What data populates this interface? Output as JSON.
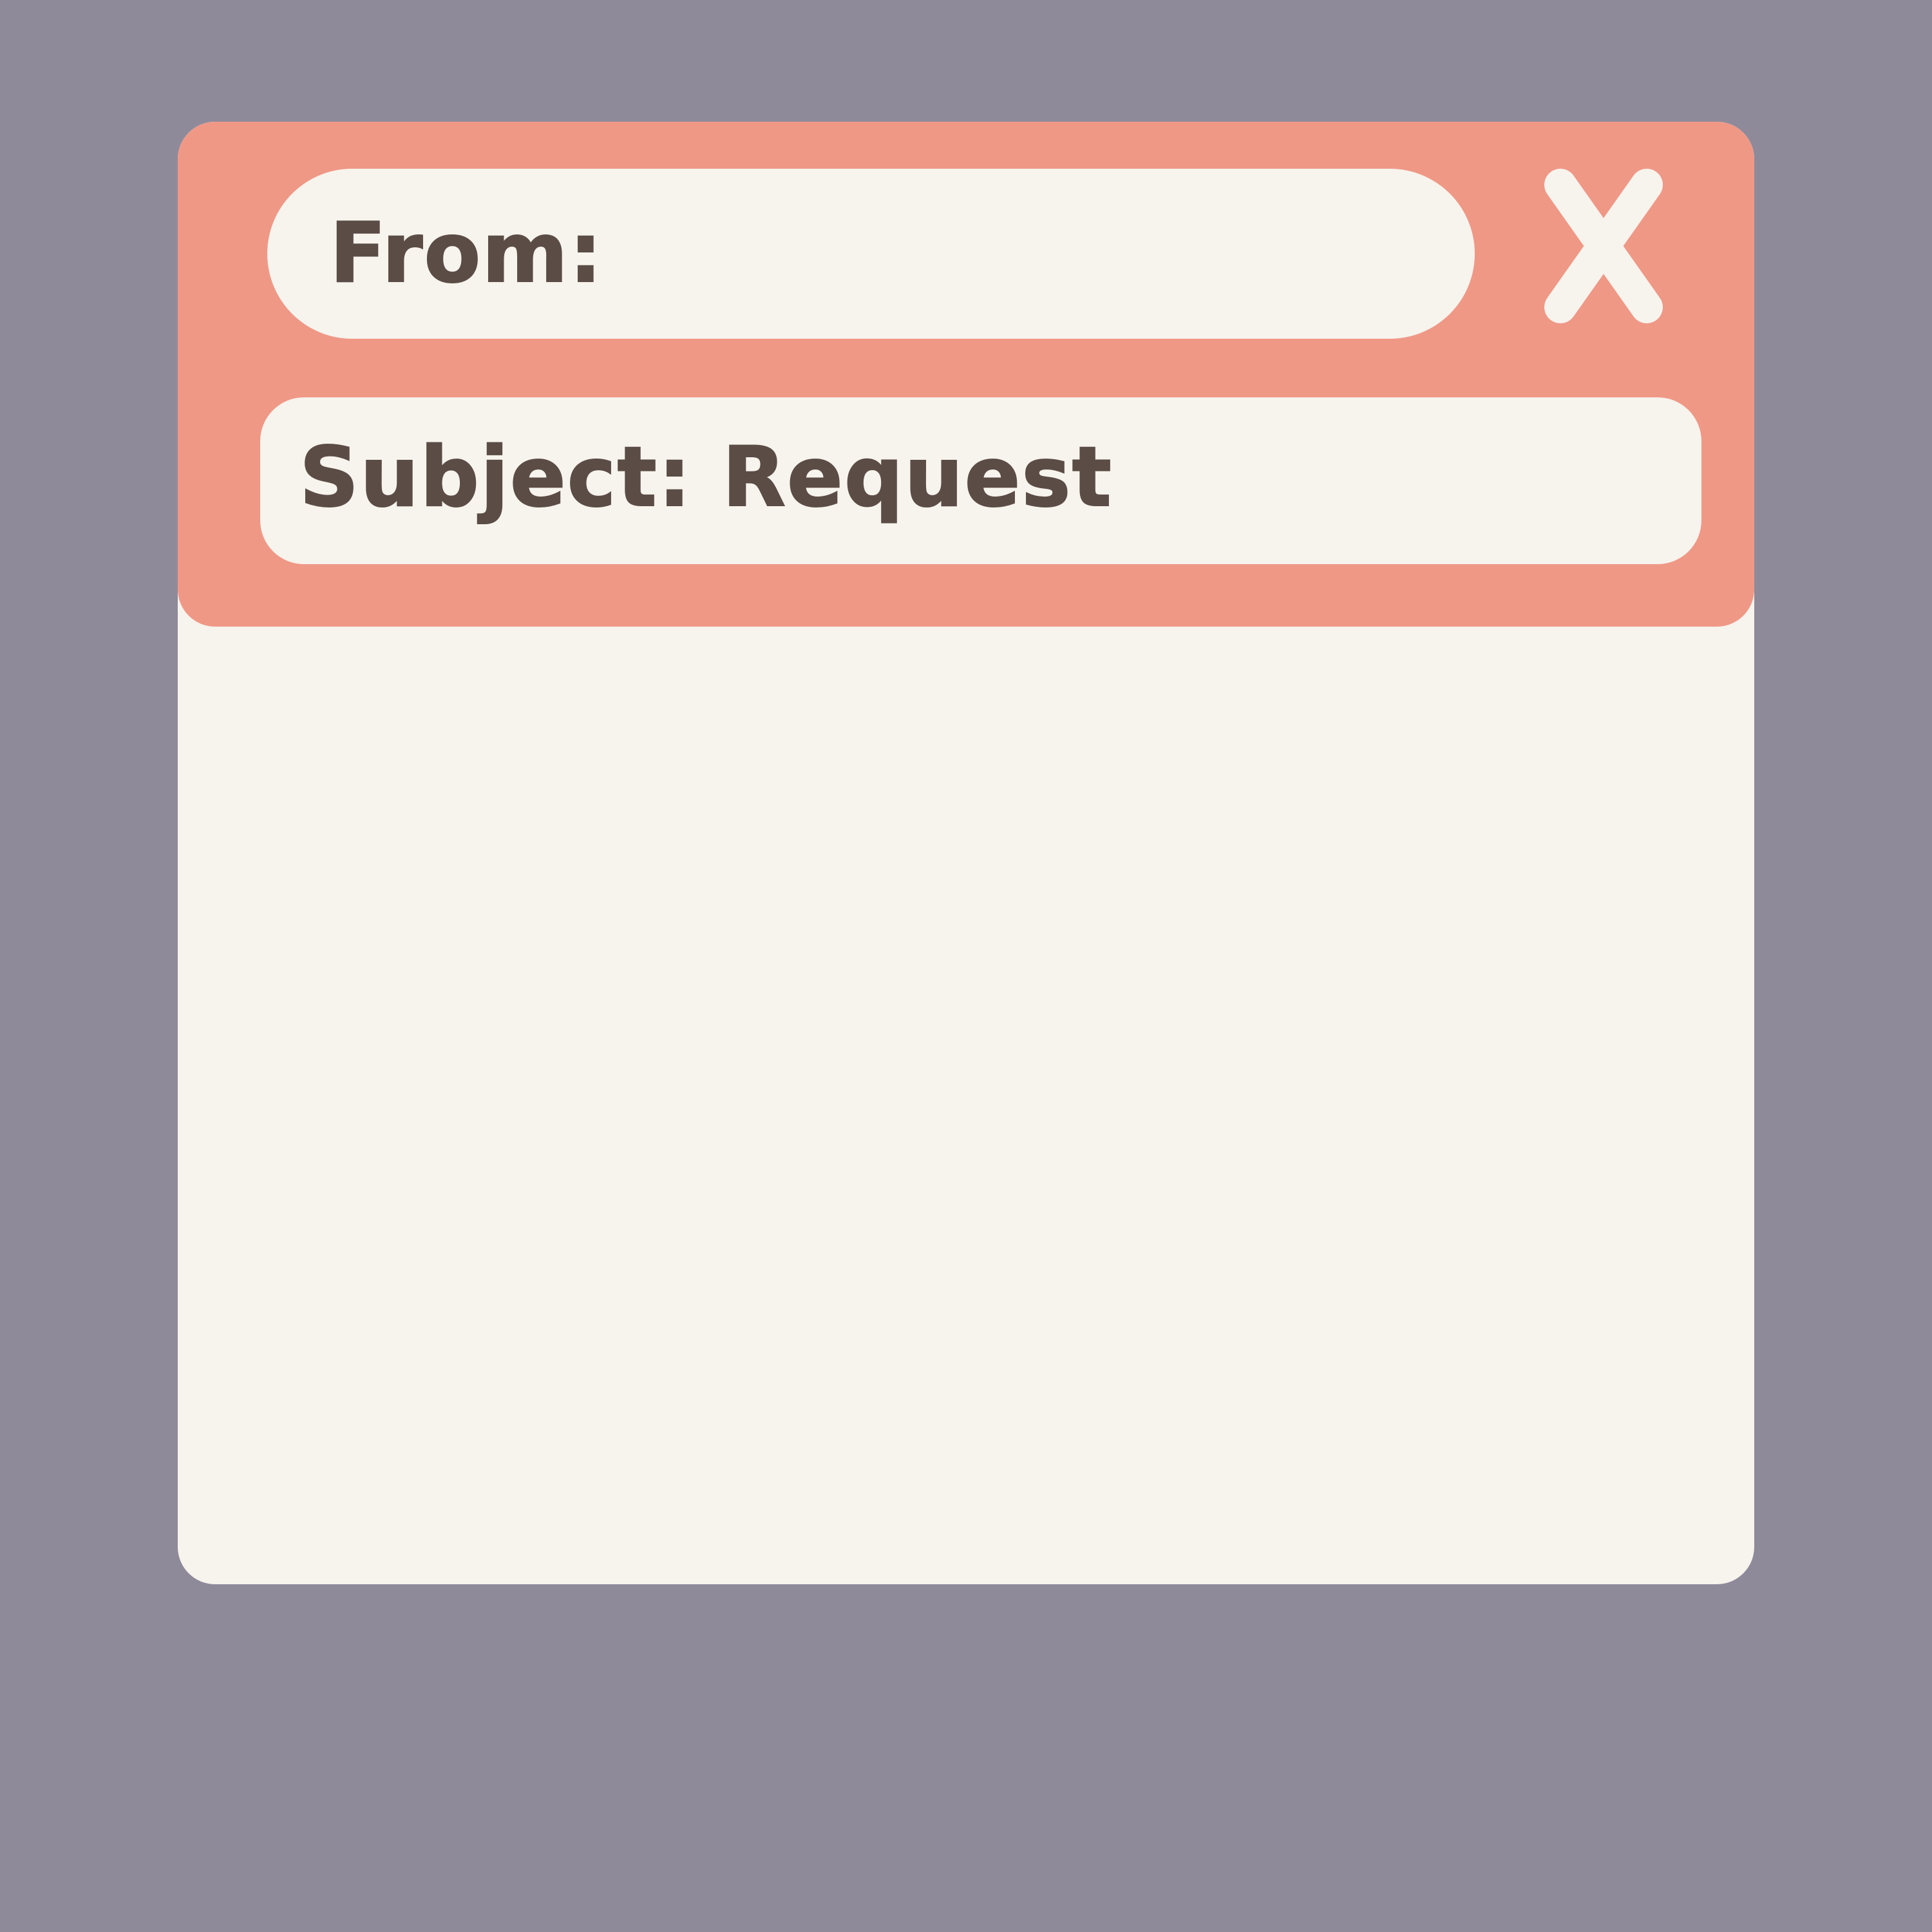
{
  "email_window": {
    "from_label": "From:",
    "subject_label": "Subject: Request",
    "close_icon": "close-icon",
    "body_text": ""
  },
  "colors": {
    "background": "#8f8a9a",
    "header": "#ef9886",
    "panel": "#f7f3ed",
    "text": "#5b4c46"
  }
}
